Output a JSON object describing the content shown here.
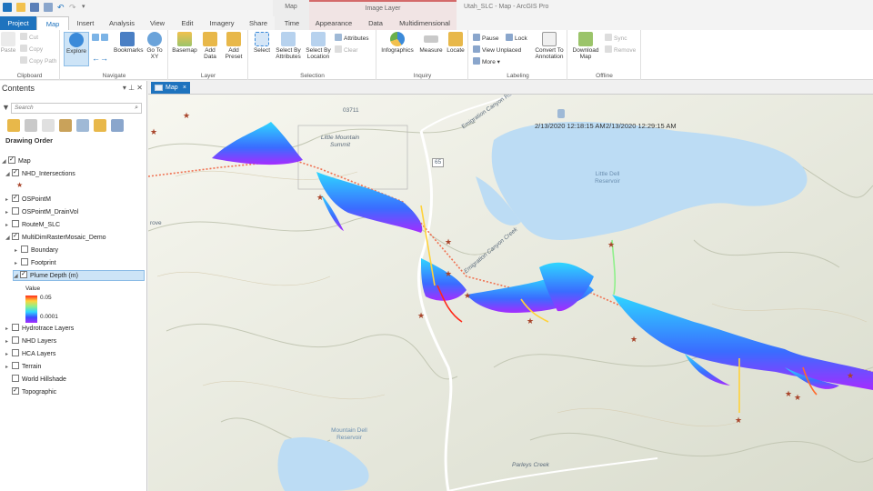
{
  "titlebar": {
    "context_map": "Map",
    "context_image_layer": "Image Layer",
    "app_title": "Utah_SLC - Map - ArcGIS Pro"
  },
  "tabs": [
    "Project",
    "Map",
    "Insert",
    "Analysis",
    "View",
    "Edit",
    "Imagery",
    "Share",
    "Time",
    "Appearance",
    "Data",
    "Multidimensional"
  ],
  "ribbon": {
    "clipboard": {
      "label": "Clipboard",
      "paste": "Paste",
      "cut": "Cut",
      "copy": "Copy",
      "copy_path": "Copy Path"
    },
    "navigate": {
      "label": "Navigate",
      "explore": "Explore",
      "bookmarks": "Bookmarks",
      "go_to_xy": "Go To XY"
    },
    "layer": {
      "label": "Layer",
      "basemap": "Basemap",
      "add_data": "Add Data",
      "add_preset": "Add Preset"
    },
    "selection": {
      "label": "Selection",
      "select": "Select",
      "select_by_attributes": "Select By Attributes",
      "select_by_location": "Select By Location",
      "attributes": "Attributes",
      "clear": "Clear"
    },
    "inquiry": {
      "label": "Inquiry",
      "infographics": "Infographics",
      "measure": "Measure",
      "locate": "Locate"
    },
    "labeling": {
      "label": "Labeling",
      "pause": "Pause",
      "lock": "Lock",
      "view_unplaced": "View Unplaced",
      "more": "More",
      "convert_to_annotation": "Convert To Annotation"
    },
    "offline": {
      "label": "Offline",
      "download_map": "Download Map",
      "sync": "Sync",
      "remove": "Remove"
    }
  },
  "contents": {
    "title": "Contents",
    "search_placeholder": "Search",
    "drawing_order": "Drawing Order",
    "layers": [
      {
        "name": "Map",
        "checked": true
      },
      {
        "name": "NHD_Intersections",
        "checked": true
      },
      {
        "name": "OSPointM",
        "checked": true
      },
      {
        "name": "OSPointM_DrainVol",
        "checked": false
      },
      {
        "name": "RouteM_SLC",
        "checked": false
      },
      {
        "name": "MultiDimRasterMosaic_Demo",
        "checked": true
      },
      {
        "name": "Boundary",
        "checked": false
      },
      {
        "name": "Footprint",
        "checked": false
      },
      {
        "name": "Plume Depth (m)",
        "checked": true
      },
      {
        "name": "Hydrotrace Layers",
        "checked": false
      },
      {
        "name": "NHD Layers",
        "checked": false
      },
      {
        "name": "HCA Layers",
        "checked": false
      },
      {
        "name": "Terrain",
        "checked": false
      },
      {
        "name": "World Hillshade",
        "checked": false
      },
      {
        "name": "Topographic",
        "checked": true
      }
    ],
    "legend": {
      "title": "Value",
      "max": "0.05",
      "min": "0.0001"
    }
  },
  "map_view": {
    "tab_label": "Map",
    "close": "×",
    "timestamps": [
      "2/13/2020 12:18:15 AM",
      "2/13/2020 12:29:15 AM"
    ],
    "labels": {
      "little_mountain": "Little Mountain Summit",
      "little_dell": "Little Dell Reservoir",
      "mountain_dell": "Mountain Dell Reservoir",
      "emigration_creek": "Emigration Canyon Rd",
      "parleys_creek": "Parleys Creek",
      "road_65": "65",
      "grove": "rove",
      "road_code": "03711",
      "canyon_creek": "Emigration Canyon Creek"
    }
  },
  "colors": {
    "accent": "#1e73be",
    "plume_high": "#ff2a1a",
    "plume_low": "#3a4cff",
    "route": "#f07050",
    "water": "#bcdcf4"
  }
}
